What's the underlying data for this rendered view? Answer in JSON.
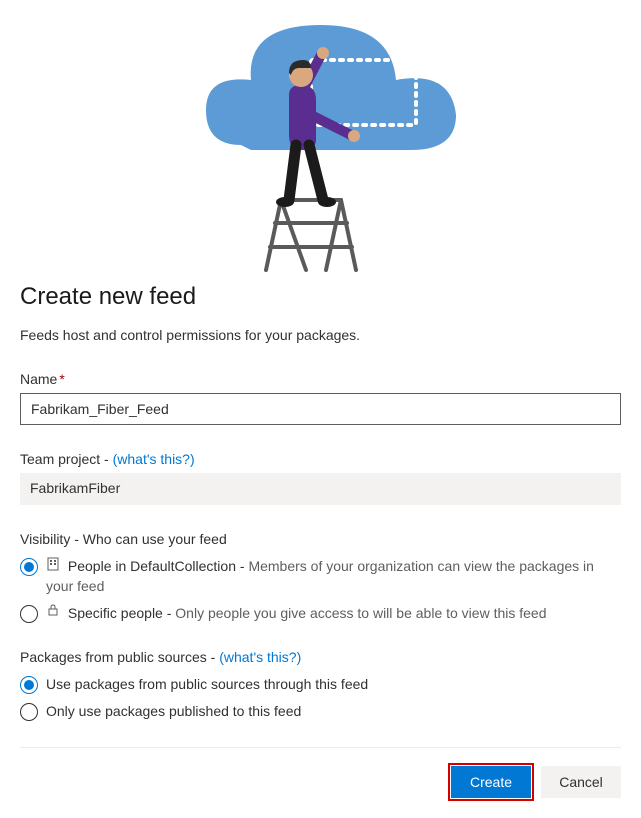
{
  "heading": "Create new feed",
  "subtitle": "Feeds host and control permissions for your packages.",
  "name": {
    "label": "Name",
    "required_marker": "*",
    "value": "Fabrikam_Fiber_Feed"
  },
  "team_project": {
    "label": "Team project -",
    "help_link": "(what's this?)",
    "value": "FabrikamFiber"
  },
  "visibility": {
    "label": "Visibility - Who can use your feed",
    "options": [
      {
        "title": "People in DefaultCollection -",
        "desc": "Members of your organization can view the packages in your feed",
        "selected": true,
        "icon": "org"
      },
      {
        "title": "Specific people -",
        "desc": "Only people you give access to will be able to view this feed",
        "selected": false,
        "icon": "lock"
      }
    ]
  },
  "public_sources": {
    "label": "Packages from public sources -",
    "help_link": "(what's this?)",
    "options": [
      {
        "label": "Use packages from public sources through this feed",
        "selected": true
      },
      {
        "label": "Only use packages published to this feed",
        "selected": false
      }
    ]
  },
  "buttons": {
    "create": "Create",
    "cancel": "Cancel"
  }
}
